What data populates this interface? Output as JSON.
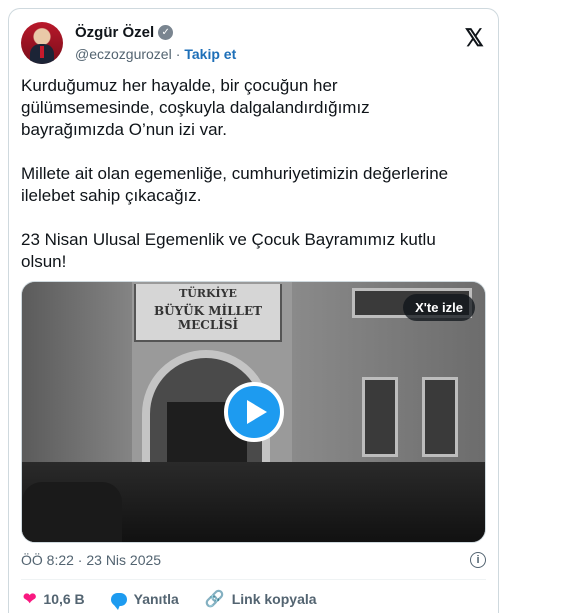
{
  "author": {
    "name": "Özgür Özel",
    "handle": "@eczozgurozel",
    "separator": "·",
    "follow_label": "Takip et"
  },
  "platform_icon": "x-logo-icon",
  "tweet": {
    "paragraphs": [
      "Kurduğumuz her hayalde, bir çocuğun her\ngülümsemesinde, coşkuyla dalgalandırdığımız\nbayrağımızda O’nun izi var.",
      "Millete ait olan egemenliğe, cumhuriyetimizin değerlerine\nilelebet sahip çıkacağız.",
      "23 Nisan Ulusal Egemenlik ve Çocuk Bayramımız kutlu\nolsun!"
    ]
  },
  "media": {
    "sign_line1": "TÜRKİYE",
    "sign_line2": "BÜYÜK MİLLET MECLİSİ",
    "watch_label": "X'te izle",
    "play_icon": "play-icon"
  },
  "meta": {
    "timestamp": "ÖÖ 8:22 · 23 Nis 2025",
    "info_icon": "info-icon"
  },
  "actions": {
    "likes": "10,6 B",
    "reply_label": "Yanıtla",
    "copy_link_label": "Link kopyala"
  },
  "colors": {
    "accent": "#1d9bf0",
    "like": "#f91880",
    "muted": "#536471",
    "follow": "#1d6fb8"
  }
}
